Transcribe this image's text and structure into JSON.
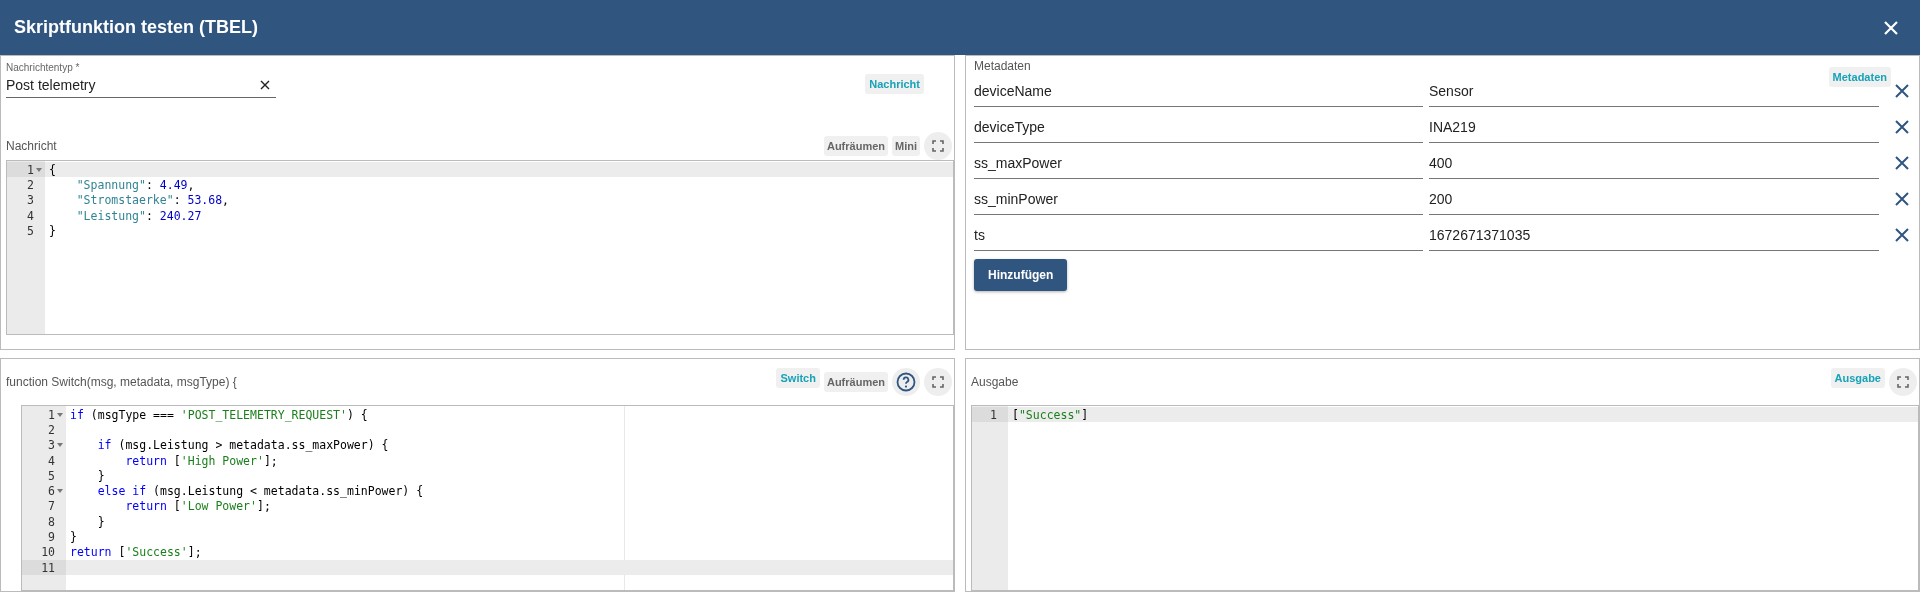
{
  "dialog": {
    "title": "Skriptfunktion testen (TBEL)"
  },
  "message_panel": {
    "type_field": {
      "label": "Nachrichtentyp *",
      "value": "Post telemetry"
    },
    "badge": "Nachricht",
    "editor_label": "Nachricht",
    "buttons": [
      "Aufräumen",
      "Mini"
    ],
    "editor": {
      "lines": [
        {
          "number": "1",
          "foldable": true,
          "active": true,
          "tokens": [
            {
              "kind": "plain",
              "text": "{"
            }
          ]
        },
        {
          "number": "2",
          "foldable": false,
          "active": false,
          "tokens": [
            {
              "kind": "key",
              "text": "    \"Spannung\""
            },
            {
              "kind": "plain",
              "text": ": "
            },
            {
              "kind": "number",
              "text": "4.49"
            },
            {
              "kind": "plain",
              "text": ","
            }
          ]
        },
        {
          "number": "3",
          "foldable": false,
          "active": false,
          "tokens": [
            {
              "kind": "key",
              "text": "    \"Stromstaerke\""
            },
            {
              "kind": "plain",
              "text": ": "
            },
            {
              "kind": "number",
              "text": "53.68"
            },
            {
              "kind": "plain",
              "text": ","
            }
          ]
        },
        {
          "number": "4",
          "foldable": false,
          "active": false,
          "tokens": [
            {
              "kind": "key",
              "text": "    \"Leistung\""
            },
            {
              "kind": "plain",
              "text": ": "
            },
            {
              "kind": "number",
              "text": "240.27"
            }
          ]
        },
        {
          "number": "5",
          "foldable": false,
          "active": false,
          "tokens": [
            {
              "kind": "plain",
              "text": "}"
            }
          ]
        }
      ]
    }
  },
  "metadata_panel": {
    "label": "Metadaten",
    "badge": "Metadaten",
    "rows": [
      {
        "key": "deviceName",
        "value": "Sensor"
      },
      {
        "key": "deviceType",
        "value": "INA219"
      },
      {
        "key": "ss_maxPower",
        "value": "400"
      },
      {
        "key": "ss_minPower",
        "value": "200"
      },
      {
        "key": "ts",
        "value": "1672671371035"
      }
    ],
    "add_button": "Hinzufügen"
  },
  "function_panel": {
    "title": "function Switch(msg, metadata, msgType) {",
    "badge": "Switch",
    "buttons": [
      "Aufräumen"
    ],
    "editor": {
      "lines": [
        {
          "number": "1",
          "foldable": true,
          "active": false,
          "tokens": [
            {
              "kind": "keyword",
              "text": "if"
            },
            {
              "kind": "plain",
              "text": " (msgType === "
            },
            {
              "kind": "string",
              "text": "'POST_TELEMETRY_REQUEST'"
            },
            {
              "kind": "plain",
              "text": ") {"
            }
          ]
        },
        {
          "number": "2",
          "foldable": false,
          "active": false
        },
        {
          "number": "3",
          "foldable": true,
          "active": false,
          "tokens": [
            {
              "kind": "keyword",
              "text": "    if"
            },
            {
              "kind": "plain",
              "text": " (msg.Leistung > metadata.ss_maxPower) {"
            }
          ]
        },
        {
          "number": "4",
          "foldable": false,
          "active": false,
          "tokens": [
            {
              "kind": "keyword",
              "text": "        return"
            },
            {
              "kind": "plain",
              "text": " ["
            },
            {
              "kind": "string",
              "text": "'High Power'"
            },
            {
              "kind": "plain",
              "text": "];"
            }
          ]
        },
        {
          "number": "5",
          "foldable": false,
          "active": false,
          "tokens": [
            {
              "kind": "plain",
              "text": "    }"
            }
          ]
        },
        {
          "number": "6",
          "foldable": true,
          "active": false,
          "tokens": [
            {
              "kind": "keyword",
              "text": "    else if"
            },
            {
              "kind": "plain",
              "text": " (msg.Leistung < metadata.ss_minPower) {"
            }
          ]
        },
        {
          "number": "7",
          "foldable": false,
          "active": false,
          "tokens": [
            {
              "kind": "keyword",
              "text": "        return"
            },
            {
              "kind": "plain",
              "text": " ["
            },
            {
              "kind": "string",
              "text": "'Low Power'"
            },
            {
              "kind": "plain",
              "text": "];"
            }
          ]
        },
        {
          "number": "8",
          "foldable": false,
          "active": false,
          "tokens": [
            {
              "kind": "plain",
              "text": "    }"
            }
          ]
        },
        {
          "number": "9",
          "foldable": false,
          "active": false,
          "tokens": [
            {
              "kind": "plain",
              "text": "}"
            }
          ]
        },
        {
          "number": "10",
          "foldable": false,
          "active": false,
          "tokens": [
            {
              "kind": "keyword",
              "text": "return"
            },
            {
              "kind": "plain",
              "text": " ["
            },
            {
              "kind": "string",
              "text": "'Success'"
            },
            {
              "kind": "plain",
              "text": "];"
            }
          ]
        },
        {
          "number": "11",
          "foldable": false,
          "active": true
        }
      ]
    }
  },
  "output_panel": {
    "label": "Ausgabe",
    "badge": "Ausgabe",
    "editor": {
      "lines": [
        {
          "number": "1",
          "foldable": false,
          "active": true,
          "tokens": [
            {
              "kind": "plain",
              "text": "["
            },
            {
              "kind": "string",
              "text": "\"Success\""
            },
            {
              "kind": "plain",
              "text": "]"
            }
          ]
        }
      ]
    }
  }
}
